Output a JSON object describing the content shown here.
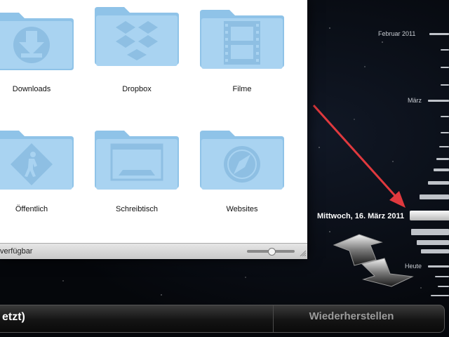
{
  "finder": {
    "items": [
      {
        "label": "Downloads",
        "icon": "download-folder-icon"
      },
      {
        "label": "Dropbox",
        "icon": "dropbox-folder-icon"
      },
      {
        "label": "Filme",
        "icon": "movies-folder-icon"
      },
      {
        "label": "Öffentlich",
        "icon": "public-folder-icon"
      },
      {
        "label": "Schreibtisch",
        "icon": "desktop-folder-icon"
      },
      {
        "label": "Websites",
        "icon": "sites-folder-icon"
      }
    ],
    "status_text": "verfügbar",
    "folder_color": "#8fc3e8"
  },
  "timeline": {
    "labels": [
      "Februar 2011",
      "März",
      "Heute"
    ],
    "current_date": "Mittwoch, 16. März 2011"
  },
  "bottom_bar": {
    "cancel_label": "etzt)",
    "restore_label": "Wiederherstellen"
  },
  "colors": {
    "annotation_arrow": "#e0393e",
    "space_background": "#05070b"
  }
}
